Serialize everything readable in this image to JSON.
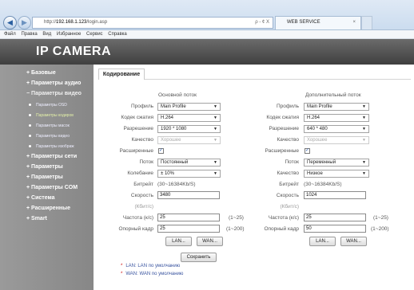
{
  "browser": {
    "url_prefix": "http://",
    "url_host": "192.168.1.123",
    "url_path": "/login.asp",
    "addr_tools": "ρ - ¢ X",
    "tab_title": "WEB SERVICE",
    "menu": [
      "Файл",
      "Правка",
      "Вид",
      "Избранное",
      "Сервис",
      "Справка"
    ]
  },
  "header": {
    "title": "IP CAMERA"
  },
  "sidebar": {
    "items": [
      "+ Базовые",
      "+ Параметры аудио",
      "− Параметры видео",
      "Параметры OSD",
      "Параметры кодиров",
      "Параметры масок",
      "Параметры видео",
      "Параметры изображ",
      "+ Параметры сети",
      "+ Параметры",
      "+ Параметры",
      "+ Параметры COM",
      "+ Система",
      "+ Расширенные",
      "+ Smart"
    ]
  },
  "content": {
    "tab": "Кодирование",
    "main_stream": "Основной поток",
    "sub_stream": "Дополнительный поток",
    "labels": {
      "profile": "Профиль",
      "codec": "Кодек сжатия",
      "resolution": "Разрешение",
      "quality": "Качество",
      "advanced": "Расширенные",
      "stream": "Поток",
      "fluctuation": "Колебание",
      "bitrate": "Битрейт",
      "speed": "Скорость",
      "kbits": "(Кбит/с)",
      "framerate": "Частота (к/с)",
      "keyframe": "Опорный кадр"
    },
    "main": {
      "profile": "Main Profile",
      "codec": "H.264",
      "resolution": "1920 * 1080",
      "quality": "Хорошее",
      "stream": "Постоянный",
      "fluctuation": "± 10%",
      "bitrate_range": "(30~16384Kb/S)",
      "speed": "3480",
      "framerate": "25",
      "framerate_range": "(1~25)",
      "keyframe": "25",
      "keyframe_range": "(1~200)"
    },
    "sub": {
      "profile": "Main Profile",
      "codec": "H.264",
      "resolution": "640 * 480",
      "quality": "Хорошее",
      "stream": "Переменный",
      "quality2": "Низкое",
      "bitrate_range": "(30~16384Kb/S)",
      "speed": "1024",
      "framerate": "25",
      "framerate_range": "(1~25)",
      "keyframe": "50",
      "keyframe_range": "(1~200)"
    },
    "buttons": {
      "lan": "LAN...",
      "wan": "WAN...",
      "save": "Сохранить"
    },
    "notes": [
      "LAN: LAN по умолчанию",
      "WAN: WAN по умолчанию"
    ],
    "note_star": "*"
  }
}
